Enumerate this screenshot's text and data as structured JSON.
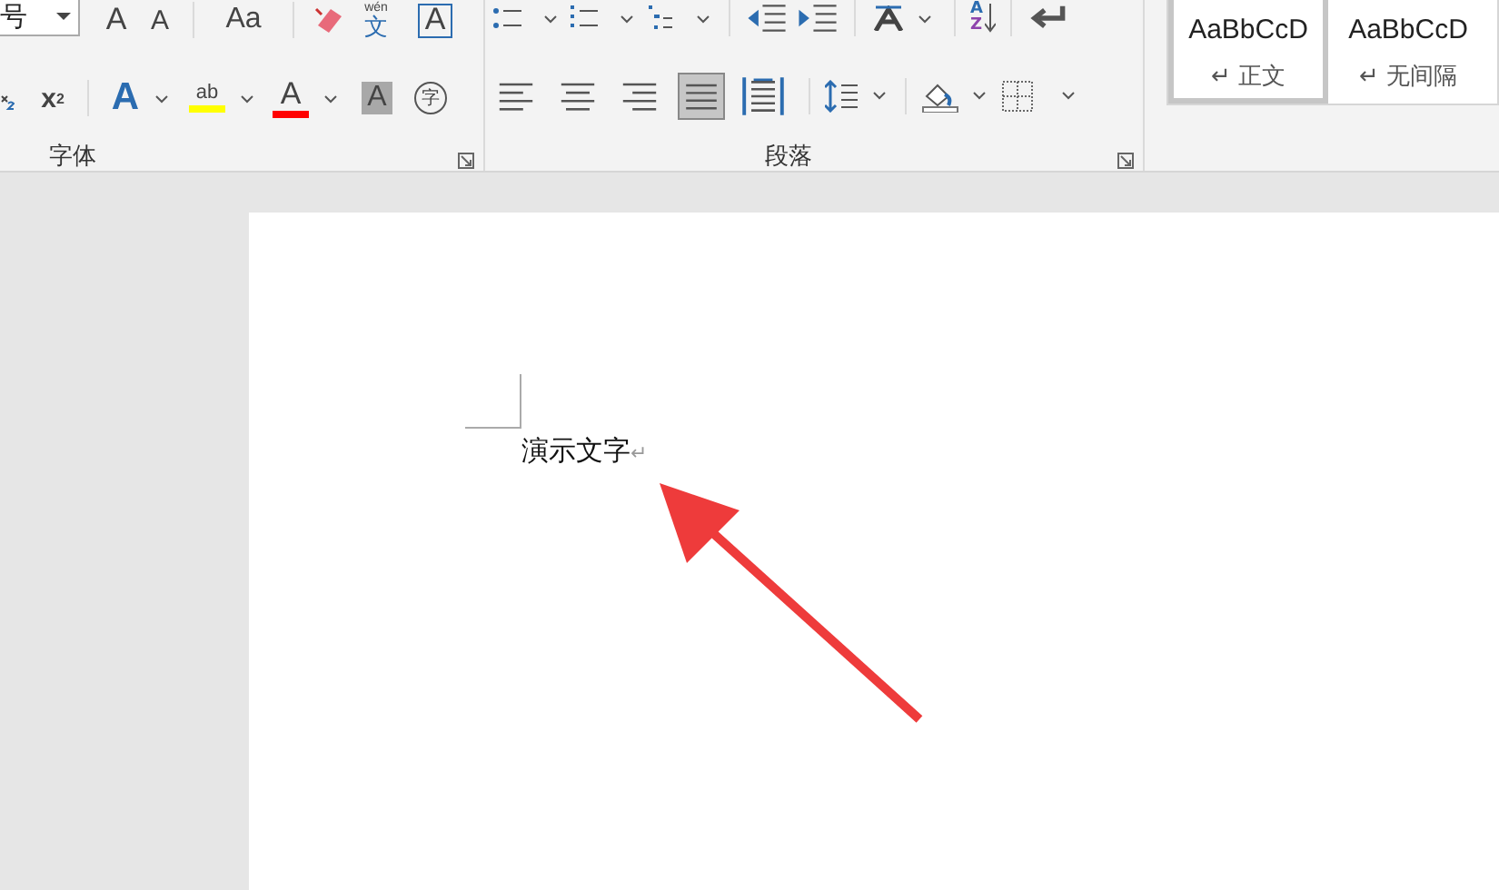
{
  "font_group": {
    "title": "字体",
    "size_value": "号",
    "grow_label": "A",
    "shrink_label": "A",
    "case_label": "Aa",
    "phonetic_top": "wén",
    "phonetic_char": "文",
    "border_label": "A",
    "superscript": "x$^{2}$",
    "effect_label": "A",
    "highlight_label": "ab",
    "color_label": "A",
    "shading_label": "A",
    "enclose_label": "字"
  },
  "paragraph_group": {
    "title": "段落",
    "sort_labels": [
      "A",
      "Z"
    ],
    "alignments": [
      {
        "kind": "left",
        "selected": false
      },
      {
        "kind": "center",
        "selected": false
      },
      {
        "kind": "right",
        "selected": false
      },
      {
        "kind": "justify",
        "selected": true
      },
      {
        "kind": "distribute",
        "selected": false
      }
    ]
  },
  "styles": [
    {
      "preview": "AaBbCcD",
      "name": "↵ 正文",
      "selected": true
    },
    {
      "preview": "AaBbCcD",
      "name": "↵ 无间隔",
      "selected": false
    }
  ],
  "document": {
    "text": "演示文字",
    "paragraph_mark": "↵"
  }
}
